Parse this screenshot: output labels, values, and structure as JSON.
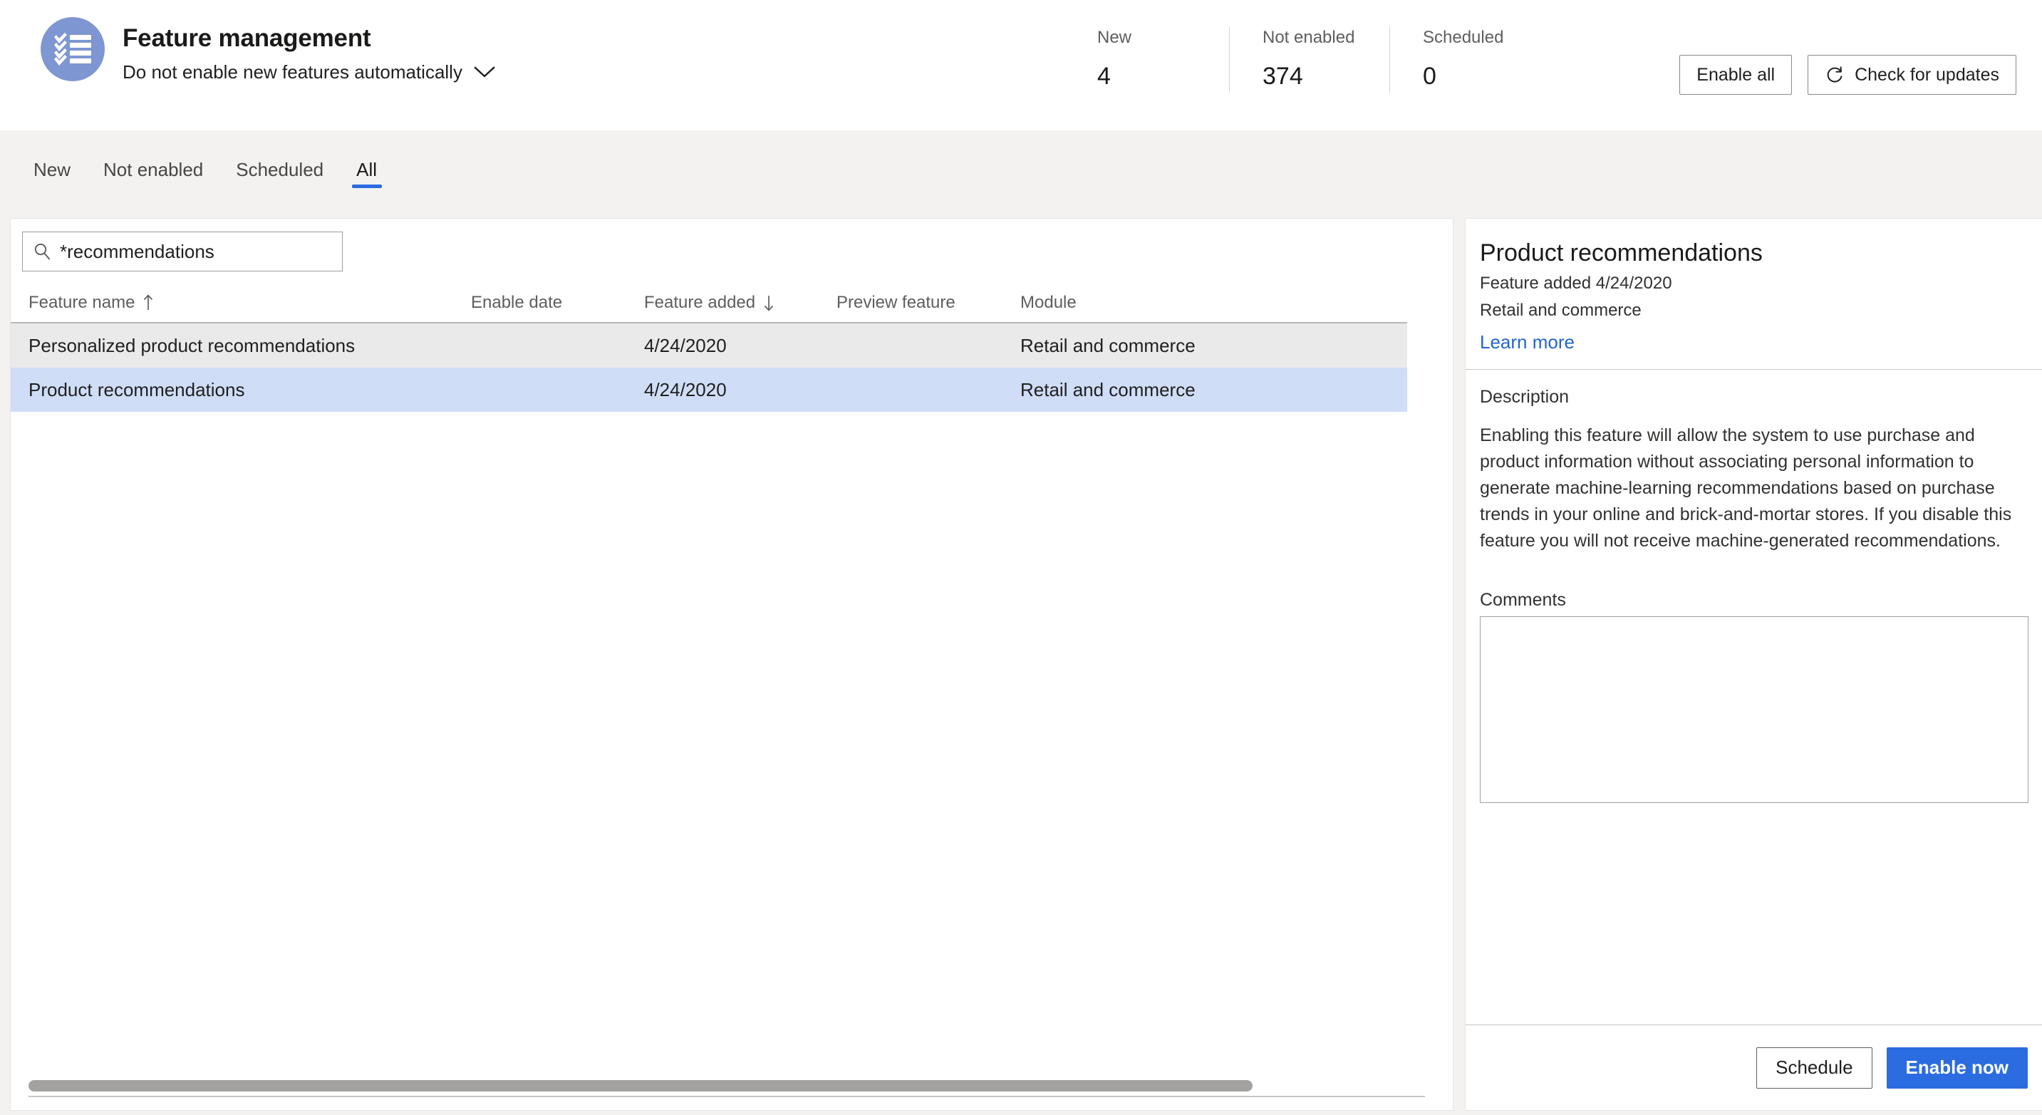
{
  "header": {
    "icon": "checklist-icon",
    "title": "Feature management",
    "subtitle": "Do not enable new features automatically",
    "chevron_icon": "chevron-down-icon",
    "stats": [
      {
        "label": "New",
        "value": "4"
      },
      {
        "label": "Not enabled",
        "value": "374"
      },
      {
        "label": "Scheduled",
        "value": "0"
      }
    ],
    "actions": {
      "enable_all": "Enable all",
      "check_updates": "Check for updates",
      "check_updates_icon": "refresh-icon"
    }
  },
  "tabs": [
    {
      "label": "New",
      "active": false
    },
    {
      "label": "Not enabled",
      "active": false
    },
    {
      "label": "Scheduled",
      "active": false
    },
    {
      "label": "All",
      "active": true
    }
  ],
  "search": {
    "value": "*recommendations",
    "placeholder": "Filter",
    "icon": "search-icon"
  },
  "table": {
    "columns": [
      {
        "label": "Feature name",
        "sort": "ascending",
        "sort_icon": "arrow-up-icon"
      },
      {
        "label": "Enable date",
        "sort": "none",
        "sort_icon": ""
      },
      {
        "label": "Feature added",
        "sort": "descending",
        "sort_icon": "arrow-down-icon"
      },
      {
        "label": "Preview feature",
        "sort": "none",
        "sort_icon": ""
      },
      {
        "label": "Module",
        "sort": "none",
        "sort_icon": ""
      }
    ],
    "rows": [
      {
        "name": "Personalized product recommendations",
        "enable_date": "",
        "feature_added": "4/24/2020",
        "preview_feature": "",
        "module": "Retail and commerce",
        "state": "hover"
      },
      {
        "name": "Product recommendations",
        "enable_date": "",
        "feature_added": "4/24/2020",
        "preview_feature": "",
        "module": "Retail and commerce",
        "state": "selected"
      }
    ]
  },
  "details": {
    "title": "Product recommendations",
    "added_line": "Feature added 4/24/2020",
    "module_line": "Retail and commerce",
    "learn_more": "Learn more",
    "description_label": "Description",
    "description_text": "Enabling this feature will allow the system to use purchase and product information without associating personal information to generate machine-learning recommendations based on purchase trends in your online and brick-and-mortar stores. If you disable this feature you will not receive machine-generated recommendations.",
    "comments_label": "Comments",
    "comments_value": "",
    "comments_placeholder": "",
    "schedule_button": "Schedule",
    "enable_now_button": "Enable now"
  },
  "colors": {
    "accent": "#2b6ce0",
    "link": "#2266cc",
    "icon_bg": "#7e96d1",
    "selected_row": "#cfddf7",
    "hover_row": "#eaeaea",
    "chrome_bg": "#f3f2f1"
  }
}
